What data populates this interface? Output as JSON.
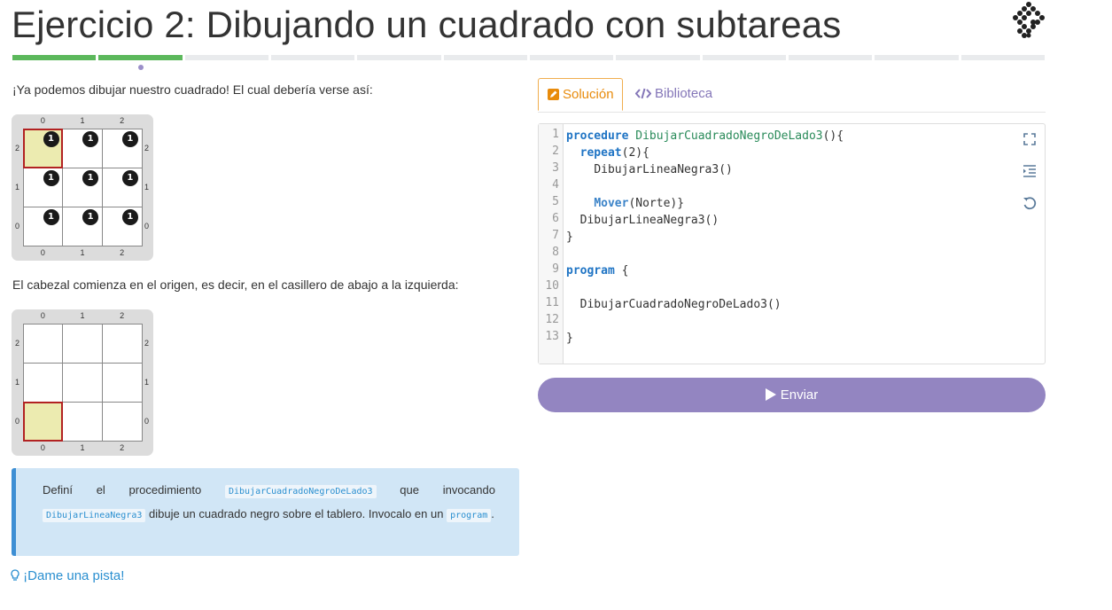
{
  "page": {
    "title": "Ejercicio 2: Dibujando un cuadrado con subtareas"
  },
  "progress": {
    "total_steps": 12,
    "completed_steps": 2,
    "current_step": 2
  },
  "colors": {
    "accent": "#9385c1",
    "done": "#5cb85c",
    "tab_active": "#e88b0c",
    "info_bg": "#d1e6f6",
    "info_border": "#3e8fd4",
    "link": "#2a8fd0"
  },
  "description": {
    "intro": "¡Ya podemos dibujar nuestro cuadrado! El cual debería verse así:",
    "intro2": "El cabezal comienza en el origen, es decir, en el casillero de abajo a la izquierda:"
  },
  "board_final": {
    "col_labels": [
      "0",
      "1",
      "2"
    ],
    "row_labels": [
      "2",
      "1",
      "0"
    ],
    "ball_count": "1",
    "head": "col 0, row 2"
  },
  "board_initial": {
    "col_labels": [
      "0",
      "1",
      "2"
    ],
    "row_labels": [
      "2",
      "1",
      "0"
    ],
    "head": "col 0, row 0"
  },
  "callout": {
    "part1": "Definí el procedimiento",
    "chip1": "DibujarCuadradoNegroDeLado3",
    "part2": "que invocando",
    "chip2": "DibujarLineaNegra3",
    "part3": "dibuje un cuadrado negro sobre el tablero. Invocalo en un",
    "chip3": "program",
    "part4": "."
  },
  "hint": {
    "label": "¡Dame una pista!"
  },
  "tabs": [
    {
      "label": "Solución",
      "icon": "edit-icon",
      "active": true
    },
    {
      "label": "Biblioteca",
      "icon": "code-icon",
      "active": false
    }
  ],
  "editor": {
    "line_numbers": [
      "1",
      "2",
      "3",
      "4",
      "5",
      "6",
      "7",
      "8",
      "9",
      "10",
      "11",
      "12",
      "13"
    ],
    "tools": [
      "expand-icon",
      "indent-icon",
      "reset-icon"
    ]
  },
  "send_button": {
    "label": "Enviar",
    "icon": "play-icon"
  }
}
